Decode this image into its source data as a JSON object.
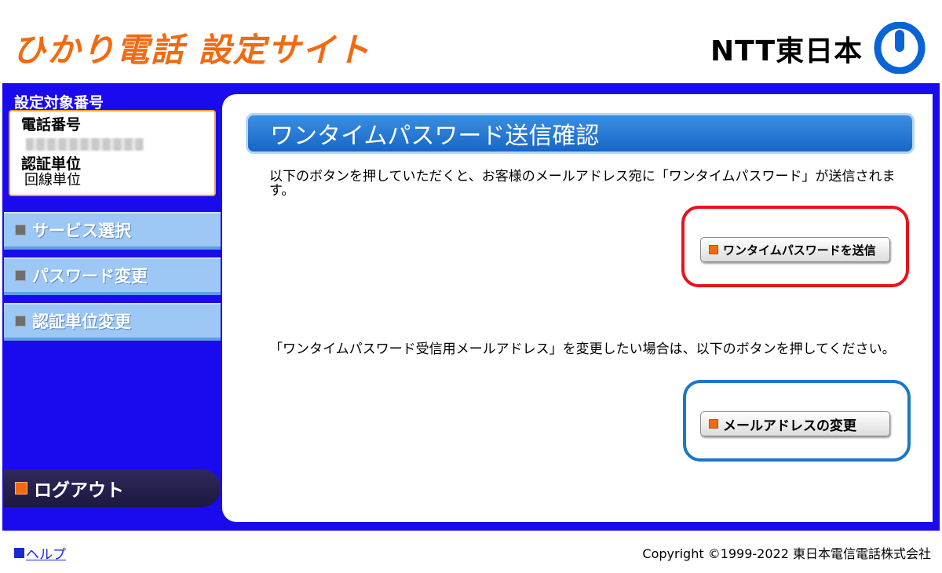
{
  "header": {
    "site_title": "ひかり電話 設定サイト",
    "company": "NTT東日本"
  },
  "sidebar": {
    "heading": "設定対象番号",
    "phone_label": "電話番号",
    "auth_label": "認証単位",
    "auth_value": "回線単位",
    "nav": [
      {
        "label": "サービス選択"
      },
      {
        "label": "パスワード変更"
      },
      {
        "label": "認証単位変更"
      }
    ],
    "logout_label": "ログアウト"
  },
  "main": {
    "title": "ワンタイムパスワード送信確認",
    "send_description": "以下のボタンを押していただくと、お客様のメールアドレス宛に「ワンタイムパスワード」が送信されます。",
    "send_button": "ワンタイムパスワードを送信",
    "change_description": "「ワンタイムパスワード受信用メールアドレス」を変更したい場合は、以下のボタンを押してください。",
    "change_button": "メールアドレスの変更"
  },
  "footer": {
    "help_link": "ヘルプ",
    "copyright": "Copyright ©1999-2022 東日本電信電話株式会社"
  },
  "colors": {
    "brand_orange": "#f26a10",
    "frame_blue": "#1a0aee",
    "title_bar_blue": "#1766c6",
    "highlight_red": "#e8121a",
    "highlight_blue": "#1a78c8"
  }
}
